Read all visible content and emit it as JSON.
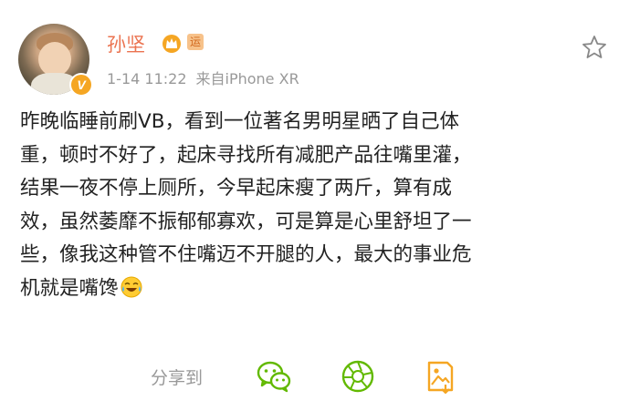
{
  "user": {
    "name": "孙坚",
    "level_badge": "运",
    "verified_badge": "V"
  },
  "meta": {
    "time": "1-14 11:22",
    "source": "来自iPhone XR"
  },
  "post": {
    "lines": [
      "昨晚临睡前刷VB，看到一位著名男明星晒了自己体",
      "重，顿时不好了，起床寻找所有减肥产品往嘴里灌，",
      "结果一夜不停上厕所，今早起床瘦了两斤，算有成",
      "效，虽然萎靡不振郁郁寡欢，可是算是心里舒坦了一",
      "些，像我这种管不住嘴迈不开腿的人，最大的事业危",
      "机就是嘴馋"
    ],
    "trailing_emoji": "laugh-cry-emoji"
  },
  "share": {
    "label": "分享到",
    "targets": [
      "wechat-icon",
      "moments-icon",
      "gallery-icon"
    ]
  },
  "colors": {
    "username": "#eb7350",
    "meta": "#999999",
    "text": "#222222",
    "share_green": "#62b900",
    "gallery_orange": "#f5a623",
    "crown": "#f5a623"
  }
}
